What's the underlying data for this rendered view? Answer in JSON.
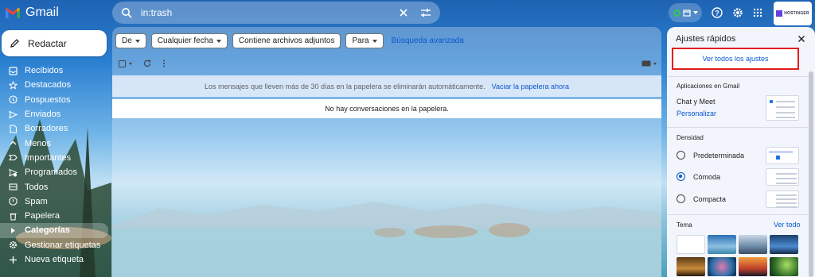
{
  "app": {
    "name": "Gmail"
  },
  "search": {
    "query": "in:trash"
  },
  "account": {
    "label": "HOSTINGER"
  },
  "compose": {
    "label": "Redactar"
  },
  "sidebar": {
    "items": [
      {
        "label": "Recibidos",
        "icon": "inbox-icon"
      },
      {
        "label": "Destacados",
        "icon": "star-icon"
      },
      {
        "label": "Pospuestos",
        "icon": "clock-icon"
      },
      {
        "label": "Enviados",
        "icon": "send-icon"
      },
      {
        "label": "Borradores",
        "icon": "draft-icon"
      },
      {
        "label": "Menos",
        "icon": "chevron-up-icon"
      },
      {
        "label": "Importantes",
        "icon": "label-important-icon"
      },
      {
        "label": "Programados",
        "icon": "scheduled-icon"
      },
      {
        "label": "Todos",
        "icon": "all-mail-icon"
      },
      {
        "label": "Spam",
        "icon": "spam-icon"
      },
      {
        "label": "Papelera",
        "icon": "trash-icon"
      },
      {
        "label": "Categorías",
        "icon": "label-icon"
      },
      {
        "label": "Gestionar etiquetas",
        "icon": "gear-icon"
      },
      {
        "label": "Nueva etiqueta",
        "icon": "plus-icon"
      }
    ]
  },
  "filters": {
    "chips": [
      "De",
      "Cualquier fecha",
      "Contiene archivos adjuntos",
      "Para"
    ],
    "advanced": "Búsqueda avanzada"
  },
  "trash": {
    "notice": "Los mensajes que lleven más de 30 días en la papelera se eliminarán automáticamente.",
    "empty_now": "Vaciar la papelera ahora",
    "empty_state": "No hay conversaciones en la papelera."
  },
  "quick_settings": {
    "title": "Ajustes rápidos",
    "see_all": "Ver todos los ajustes",
    "apps_heading": "Aplicaciones en Gmail",
    "apps_item": "Chat y Meet",
    "customize": "Personalizar",
    "density_heading": "Densidad",
    "density_options": [
      "Predeterminada",
      "Cómoda",
      "Compacta"
    ],
    "density_selected": "Cómoda",
    "theme_heading": "Tema",
    "theme_view_all": "Ver todo"
  },
  "colors": {
    "accent": "#0b57d0",
    "highlight_border": "#e11d1d",
    "panel": "#f2f6fc"
  }
}
